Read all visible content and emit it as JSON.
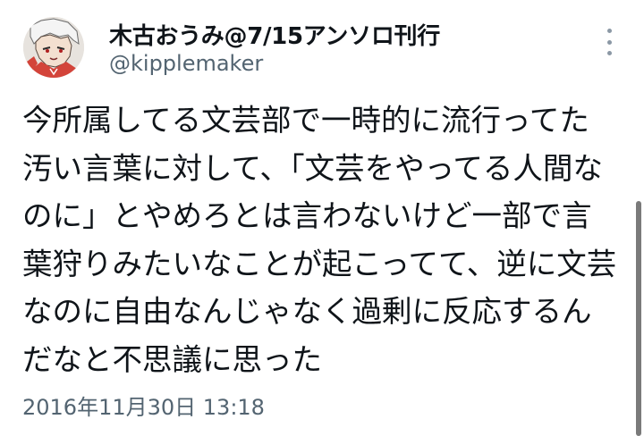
{
  "author": {
    "display_name": "木古おうみ@7/15アンソロ刊行",
    "handle": "@kipplemaker",
    "avatar_icon": "illustrated-character-avatar"
  },
  "menu": {
    "icon": "more-vertical-icon"
  },
  "tweet": {
    "lines": [
      "今所属してる文芸部で一時的に流行ってた",
      "汚い言葉に対して、「文芸をやってる人間な",
      "のに」とやめろとは言わないけど一部で言",
      "葉狩りみたいなことが起こってて、逆に文芸",
      "なのに自由なんじゃなく過剰に反応するん",
      "だなと不思議に思った"
    ],
    "timestamp": "2016年11月30日 13:18"
  },
  "colors": {
    "text_primary": "#0f1419",
    "text_secondary": "#536471",
    "background": "#ffffff"
  }
}
